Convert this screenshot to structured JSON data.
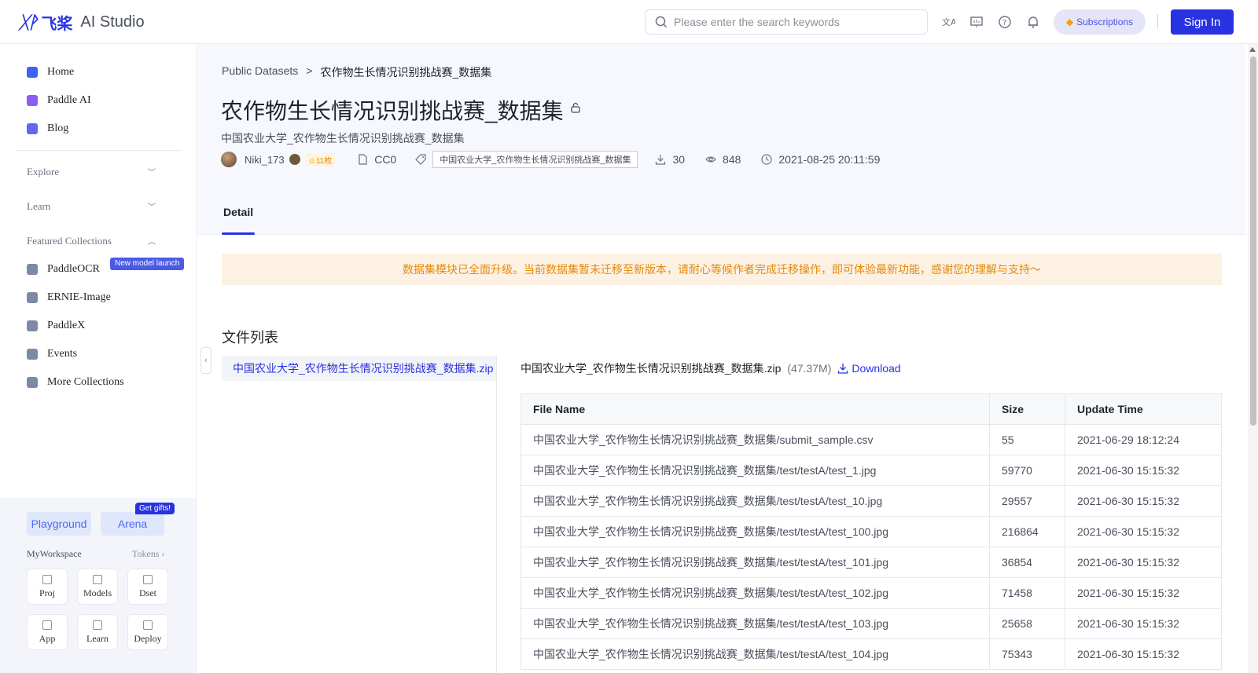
{
  "brand": {
    "logo_mark": "ᚷᚹ",
    "logo_cn": "飞桨",
    "logo_en": "AI Studio"
  },
  "search": {
    "placeholder": "Please enter the search keywords"
  },
  "topbar": {
    "subscriptions_label": "Subscriptions",
    "signin_label": "Sign In",
    "accent": "#2932e1"
  },
  "sidebar": {
    "items": [
      {
        "label": "Home",
        "icon": "home-icon",
        "color": "#3b63f6"
      },
      {
        "label": "Paddle AI",
        "icon": "paddle-ai-icon",
        "color": "#8b5cf6"
      },
      {
        "label": "Blog",
        "icon": "blog-icon",
        "color": "#6366f1"
      }
    ],
    "sections": [
      {
        "label": "Explore",
        "state": "collapsed"
      },
      {
        "label": "Learn",
        "state": "collapsed"
      },
      {
        "label": "Featured Collections",
        "state": "expanded"
      }
    ],
    "collections": [
      {
        "label": "PaddleOCR",
        "icon": "paddleocr-icon"
      },
      {
        "label": "ERNIE-Image",
        "icon": "ernie-image-icon"
      },
      {
        "label": "PaddleX",
        "icon": "paddlex-icon"
      },
      {
        "label": "Events",
        "icon": "flag-icon"
      },
      {
        "label": "More Collections",
        "icon": "collections-icon"
      }
    ],
    "new_badge": "New model launch",
    "playground_label": "Playground",
    "arena_label": "Arena",
    "gift_badge": "Get gifts!",
    "workspace_title": "MyWorkspace",
    "tokens_label": "Tokens",
    "tiles": [
      {
        "label": "Proj",
        "icon": "folder-icon"
      },
      {
        "label": "Models",
        "icon": "cube-icon"
      },
      {
        "label": "Dset",
        "icon": "bar-chart-icon"
      },
      {
        "label": "App",
        "icon": "grid-icon"
      },
      {
        "label": "Learn",
        "icon": "book-icon"
      },
      {
        "label": "Deploy",
        "icon": "rocket-icon"
      }
    ]
  },
  "breadcrumb": {
    "root": "Public Datasets",
    "separator": ">",
    "current": "农作物生长情况识别挑战赛_数据集"
  },
  "dataset": {
    "title": "农作物生长情况识别挑战赛_数据集",
    "subtitle": "中国农业大学_农作物生长情况识别挑战赛_数据集",
    "author": "Niki_173",
    "coins": "11枚",
    "license": "CC0",
    "tag": "中国农业大学_农作物生长情况识别挑战赛_数据集",
    "downloads": "30",
    "views": "848",
    "created": "2021-08-25 20:11:59"
  },
  "tabs": {
    "detail": "Detail"
  },
  "notice": "数据集模块已全面升级。当前数据集暂未迁移至新版本，请耐心等候作者完成迁移操作，即可体验最新功能，感谢您的理解与支持～",
  "files": {
    "title": "文件列表",
    "list": [
      "中国农业大学_农作物生长情况识别挑战赛_数据集.zip"
    ],
    "selected_name": "中国农业大学_农作物生长情况识别挑战赛_数据集.zip",
    "selected_size": "(47.37M)",
    "download_label": "Download",
    "columns": [
      "File Name",
      "Size",
      "Update Time"
    ],
    "rows": [
      [
        "中国农业大学_农作物生长情况识别挑战赛_数据集/submit_sample.csv",
        "55",
        "2021-06-29 18:12:24"
      ],
      [
        "中国农业大学_农作物生长情况识别挑战赛_数据集/test/testA/test_1.jpg",
        "59770",
        "2021-06-30 15:15:32"
      ],
      [
        "中国农业大学_农作物生长情况识别挑战赛_数据集/test/testA/test_10.jpg",
        "29557",
        "2021-06-30 15:15:32"
      ],
      [
        "中国农业大学_农作物生长情况识别挑战赛_数据集/test/testA/test_100.jpg",
        "216864",
        "2021-06-30 15:15:32"
      ],
      [
        "中国农业大学_农作物生长情况识别挑战赛_数据集/test/testA/test_101.jpg",
        "36854",
        "2021-06-30 15:15:32"
      ],
      [
        "中国农业大学_农作物生长情况识别挑战赛_数据集/test/testA/test_102.jpg",
        "71458",
        "2021-06-30 15:15:32"
      ],
      [
        "中国农业大学_农作物生长情况识别挑战赛_数据集/test/testA/test_103.jpg",
        "25658",
        "2021-06-30 15:15:32"
      ],
      [
        "中国农业大学_农作物生长情况识别挑战赛_数据集/test/testA/test_104.jpg",
        "75343",
        "2021-06-30 15:15:32"
      ]
    ]
  }
}
